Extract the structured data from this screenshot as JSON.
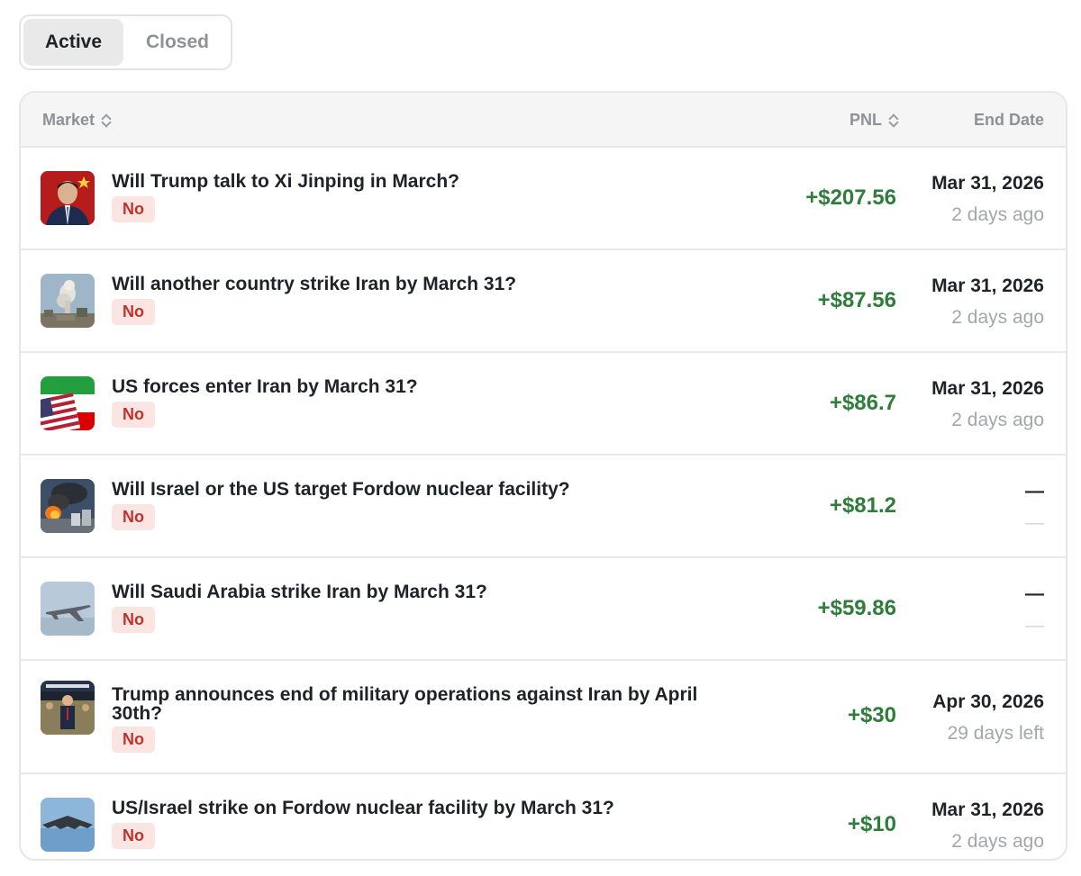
{
  "tabs": [
    {
      "label": "Active",
      "selected": true
    },
    {
      "label": "Closed",
      "selected": false
    }
  ],
  "table": {
    "columns": {
      "market": "Market",
      "pnl": "PNL",
      "end_date": "End Date"
    },
    "rows": [
      {
        "question": "Will Trump talk to Xi Jinping in March?",
        "outcome": "No",
        "pnl": "+$207.56",
        "end_date": "Mar 31, 2026",
        "relative": "2 days ago",
        "thumb": "portrait-flag-image"
      },
      {
        "question": "Will another country strike Iran by March 31?",
        "outcome": "No",
        "pnl": "+$87.56",
        "end_date": "Mar 31, 2026",
        "relative": "2 days ago",
        "thumb": "smoke-plume-image"
      },
      {
        "question": "US forces enter Iran by March 31?",
        "outcome": "No",
        "pnl": "+$86.7",
        "end_date": "Mar 31, 2026",
        "relative": "2 days ago",
        "thumb": "flags-image"
      },
      {
        "question": "Will Israel or the US target Fordow nuclear facility?",
        "outcome": "No",
        "pnl": "+$81.2",
        "end_date": "—",
        "relative": "—",
        "thumb": "explosion-image"
      },
      {
        "question": "Will Saudi Arabia strike Iran by March 31?",
        "outcome": "No",
        "pnl": "+$59.86",
        "end_date": "—",
        "relative": "—",
        "thumb": "fighter-jet-image"
      },
      {
        "question": "Trump announces end of military operations against Iran by April 30th?",
        "outcome": "No",
        "pnl": "+$30",
        "end_date": "Apr 30, 2026",
        "relative": "29 days left",
        "thumb": "podium-speech-image"
      },
      {
        "question": "US/Israel strike on Fordow nuclear facility by March 31?",
        "outcome": "No",
        "pnl": "+$10",
        "end_date": "Mar 31, 2026",
        "relative": "2 days ago",
        "thumb": "stealth-bomber-image"
      }
    ]
  },
  "colors": {
    "positive_pnl": "#2e7d3a",
    "no_badge_bg": "#fbe5e3",
    "no_badge_text": "#c0322a",
    "muted": "#a3a6ab"
  }
}
